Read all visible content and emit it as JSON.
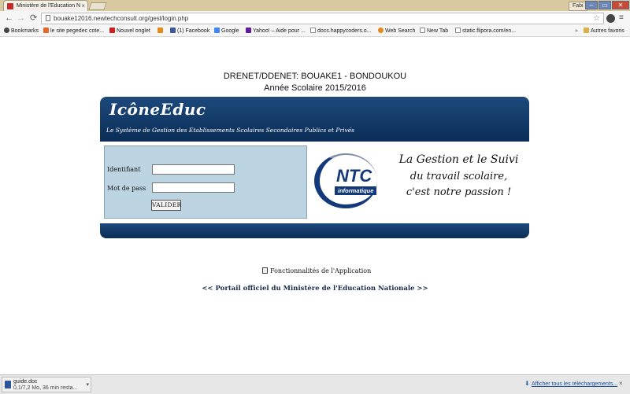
{
  "browser": {
    "tab_title": "Ministère de l'Education N",
    "tab_close": "×",
    "user_badge": "Fabi",
    "win_min": "–",
    "win_max": "▭",
    "win_close": "✕",
    "nav_back": "←",
    "nav_forward": "→",
    "nav_reload": "⟳",
    "url": "bouake12016.newtechconsult.org/gesl/login.php",
    "star": "☆",
    "menu": "≡",
    "bookmarks": [
      {
        "label": "Bookmarks",
        "color": "#444444"
      },
      {
        "label": "le site pegedec cote...",
        "color": "#e2672b"
      },
      {
        "label": "Nouvel onglet",
        "color": "#cc1f1f"
      },
      {
        "label": "(1) Facebook",
        "color": "#3b5998"
      },
      {
        "label": "Google",
        "color": "#4285f4"
      },
      {
        "label": "Yahoo! – Aide pour ...",
        "color": "#5f1d9e"
      },
      {
        "label": "docs.happycoders.o...",
        "color": "#888888"
      },
      {
        "label": "Web Search",
        "color": "#e28a1c"
      },
      {
        "label": "New Tab",
        "color": "#888888"
      },
      {
        "label": "static.flipora.com/en...",
        "color": "#888888"
      }
    ],
    "bookmarks_more": "»",
    "other_bookmarks": "Autres favoris"
  },
  "page": {
    "header_line1": "DRENET/DDENET: BOUAKE1 - BONDOUKOU",
    "header_line2": "Année Scolaire 2015/2016",
    "brand_title": "IcôneEduc",
    "brand_subtitle": "Le Système de Gestion des Etablissements Scolaires Secondaires Publics et Privés",
    "login": {
      "identifiant_label": "Identifiant",
      "identifiant_value": "",
      "password_label": "Mot de pass",
      "password_value": "",
      "submit_label": "VALIDER"
    },
    "promo": {
      "logo_text": "NTC",
      "logo_tagline": "informatique",
      "slogan_line1": "La Gestion et le Suivi",
      "slogan_line2": "du travail scolaire,",
      "slogan_line3": "c'est notre passion !"
    },
    "functionalities_link": "Fonctionnalités de l'Application",
    "portal_link": "<< Portail officiel du Ministère de l'Education Nationale >>"
  },
  "downloads": {
    "file_name": "guide.doc",
    "file_status": "0,1/7,2 Mo, 36 min resta...",
    "item_menu": "▾",
    "show_all": "Afficher tous les téléchargements...",
    "close": "×"
  },
  "colors": {
    "banner_dark": "#0b2d57",
    "banner_light": "#1d4a7c",
    "login_panel": "#bcd3e2",
    "ntc_blue": "#13397a"
  }
}
